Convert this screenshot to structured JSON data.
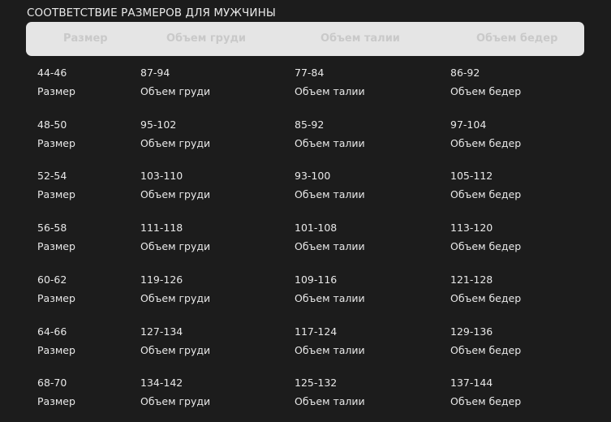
{
  "title": "СООТВЕТСТВИЕ РАЗМЕРОВ ДЛЯ МУЖЧИНЫ",
  "headers": [
    "Размер",
    "Объем груди",
    "Объем талии",
    "Объем бедер"
  ],
  "rows": [
    [
      "44-46",
      "87-94",
      "77-84",
      "86-92"
    ],
    [
      "48-50",
      "95-102",
      "85-92",
      "97-104"
    ],
    [
      "52-54",
      "103-110",
      "93-100",
      "105-112"
    ],
    [
      "56-58",
      "111-118",
      "101-108",
      "113-120"
    ],
    [
      "60-62",
      "119-126",
      "109-116",
      "121-128"
    ],
    [
      "64-66",
      "127-134",
      "117-124",
      "129-136"
    ],
    [
      "68-70",
      "134-142",
      "125-132",
      "137-144"
    ]
  ]
}
